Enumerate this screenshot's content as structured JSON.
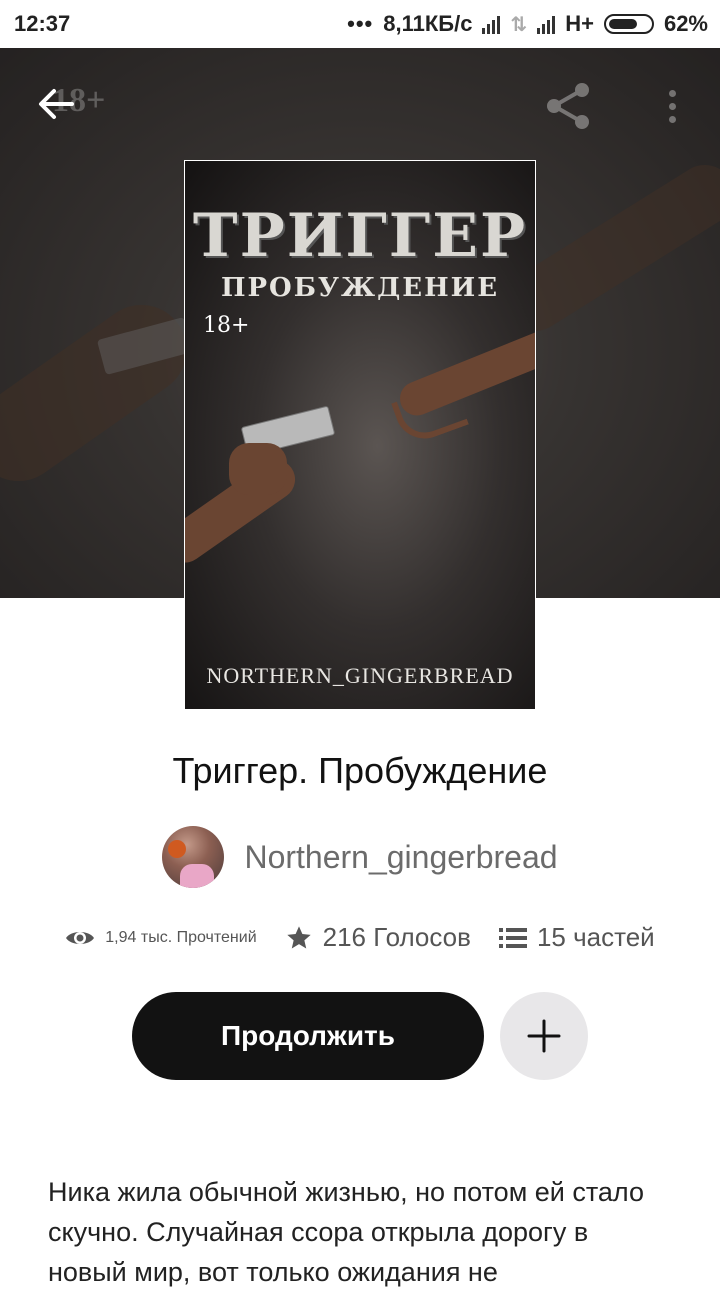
{
  "status_bar": {
    "time": "12:37",
    "dots": "•••",
    "speed": "8,11КБ/с",
    "network": "H+",
    "battery": "62%"
  },
  "header": {
    "rating_badge": "18+",
    "back_icon": "arrow-left-icon",
    "share_icon": "share-icon",
    "more_icon": "more-vertical-icon"
  },
  "cover": {
    "title": "ТРИГГЕР",
    "subtitle": "ПРОБУЖДЕНИЕ",
    "rating": "18+",
    "author": "NORTHERN_GINGERBREAD"
  },
  "book": {
    "title": "Триггер. Пробуждение",
    "author": "Northern_gingerbread"
  },
  "stats": {
    "reads": "1,94 тыс. Прочтений",
    "votes": "216 Голосов",
    "parts": "15 частей"
  },
  "actions": {
    "continue_label": "Продолжить",
    "add_icon": "plus-icon"
  },
  "description": "Ника жила обычной жизнью, но потом ей стало скучно. Случайная ссора открыла дорогу в новый мир, вот только ожидания не",
  "colors": {
    "primary_button": "#121212",
    "secondary_button": "#e8e7e9",
    "text_muted": "#6b6b6b"
  }
}
